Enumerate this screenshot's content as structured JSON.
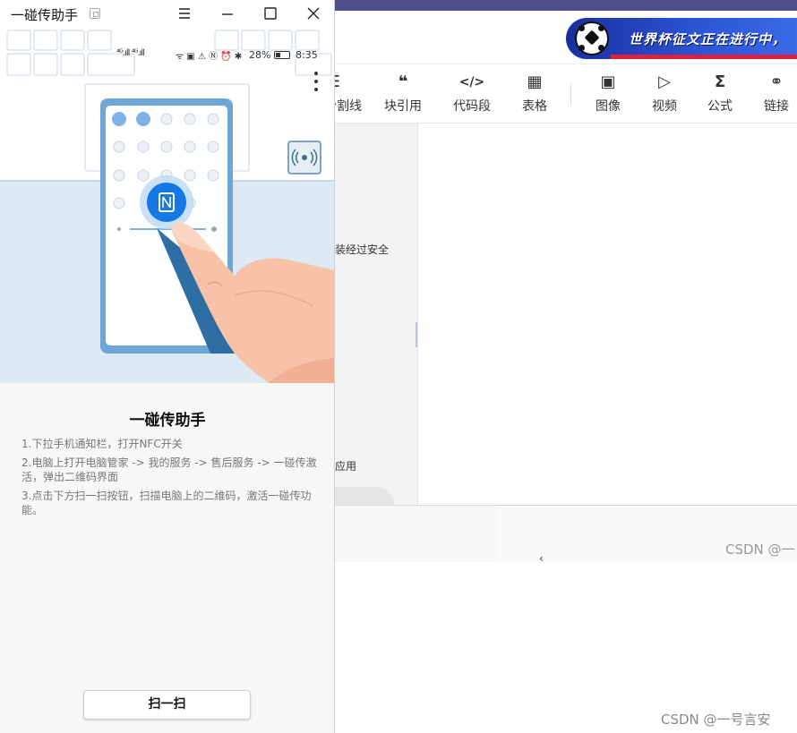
{
  "window": {
    "title": "一碰传助手"
  },
  "phone_status": {
    "signal": "⁴ᴳ.ıll ⁴ᴳ.ıll",
    "battery": "28%",
    "time": "8:35"
  },
  "guide": {
    "title": "一碰传助手",
    "steps": [
      "1.下拉手机通知栏，打开NFC开关",
      "2.电脑上打开电脑管家 -> 我的服务 -> 售后服务 -> 一碰传激活，弹出二维码界面",
      "3.点击下方扫一扫按钮，扫描电脑上的二维码，激活一碰传功能。"
    ],
    "scan_button": "扫一扫"
  },
  "editor": {
    "banner_text": "世界杯征文正在进行中，",
    "toolbar": [
      {
        "icon": "divider-icon",
        "glyph": "☰",
        "label": "分割线"
      },
      {
        "icon": "quote-icon",
        "glyph": "❝",
        "label": "块引用"
      },
      {
        "icon": "code-icon",
        "glyph": "</>",
        "label": "代码段"
      },
      {
        "icon": "table-icon",
        "glyph": "▦",
        "label": "表格"
      },
      {
        "icon": "image-icon",
        "glyph": "▣",
        "label": "图像"
      },
      {
        "icon": "video-icon",
        "glyph": "▷",
        "label": "视频"
      },
      {
        "icon": "formula-icon",
        "glyph": "Σ",
        "label": "公式"
      },
      {
        "icon": "link-icon",
        "glyph": "⚭",
        "label": "链接"
      }
    ],
    "side_text_1": "装经过安全",
    "side_text_2": "应用",
    "watermark_inner": "CSDN @一",
    "watermark": "CSDN @一号言安"
  },
  "colors": {
    "nfc_blue": "#1677e6",
    "hand_skin": "#f7c2a8",
    "sky": "#dde9f3",
    "title_bar_purple": "#4f4f8c"
  }
}
